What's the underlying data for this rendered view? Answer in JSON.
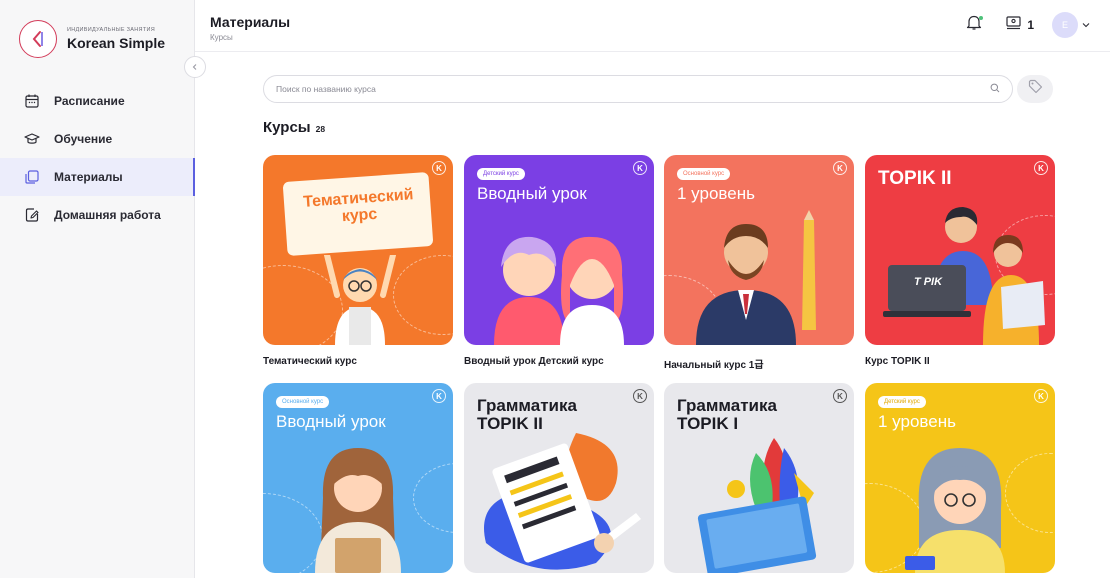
{
  "brand": {
    "subtitle": "индивидуальные занятия",
    "name": "Korean Simple"
  },
  "sidebar": {
    "items": [
      {
        "label": "Расписание",
        "icon": "calendar-icon",
        "active": false
      },
      {
        "label": "Обучение",
        "icon": "graduation-cap-icon",
        "active": false
      },
      {
        "label": "Материалы",
        "icon": "materials-icon",
        "active": true
      },
      {
        "label": "Домашняя работа",
        "icon": "homework-icon",
        "active": false
      }
    ]
  },
  "header": {
    "title": "Материалы",
    "breadcrumb": "Курсы",
    "lessons_count": "1",
    "avatar_initial": "E"
  },
  "search": {
    "placeholder": "Поиск по названию курса",
    "value": ""
  },
  "section": {
    "title": "Курсы",
    "count": "28"
  },
  "colors": {
    "accent": "#5b5fe0",
    "orange": "#f4782b",
    "purple": "#7b3fe4",
    "coral": "#f3735e",
    "red": "#ee3d43",
    "blue": "#5aaeee",
    "gray": "#e8e8ec",
    "yellow": "#f5c518"
  },
  "courses": [
    {
      "name": "Тематический курс",
      "badge": "",
      "cover_title": "Тематический курс",
      "bg": "#f4782b"
    },
    {
      "name": "Вводный урок Детский курс",
      "badge": "Детский курс",
      "cover_title": "Вводный урок",
      "bg": "#7b3fe4"
    },
    {
      "name": "Начальный курс 1급",
      "badge": "Основной курс",
      "cover_title": "1 уровень",
      "bg": "#f3735e"
    },
    {
      "name": "Курс TOPIK II",
      "badge": "",
      "cover_title": "TOPIK II",
      "bg": "#ee3d43"
    },
    {
      "name": "",
      "badge": "Основной курс",
      "cover_title": "Вводный урок",
      "bg": "#5aaeee"
    },
    {
      "name": "",
      "badge": "",
      "cover_title": "Грамматика TOPIK II",
      "bg": "#e8e8ec"
    },
    {
      "name": "",
      "badge": "",
      "cover_title": "Грамматика TOPIK I",
      "bg": "#e8e8ec"
    },
    {
      "name": "",
      "badge": "Детский курс",
      "cover_title": "1 уровень",
      "bg": "#f5c518"
    }
  ],
  "card_extras": {
    "topik_laptop_label": "T PIK"
  }
}
